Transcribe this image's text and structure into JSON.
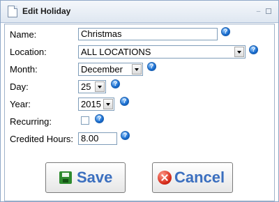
{
  "window": {
    "title": "Edit Holiday",
    "title_icon": "document-icon",
    "controls": [
      "minimize-icon",
      "restore-icon"
    ]
  },
  "form": {
    "name": {
      "label": "Name:",
      "value": "Christmas"
    },
    "location": {
      "label": "Location:",
      "value": "ALL LOCATIONS"
    },
    "month": {
      "label": "Month:",
      "value": "December"
    },
    "day": {
      "label": "Day:",
      "value": "25"
    },
    "year": {
      "label": "Year:",
      "value": "2015"
    },
    "recurring": {
      "label": "Recurring:",
      "checked": false
    },
    "credited_hours": {
      "label": "Credited Hours:",
      "value": "8.00"
    },
    "help_icon": "help-icon"
  },
  "buttons": {
    "save_label": "Save",
    "cancel_label": "Cancel"
  },
  "colors": {
    "accent": "#3b6fbf",
    "title_bar": "#dfe7f1",
    "border": "#8fa8c8"
  }
}
